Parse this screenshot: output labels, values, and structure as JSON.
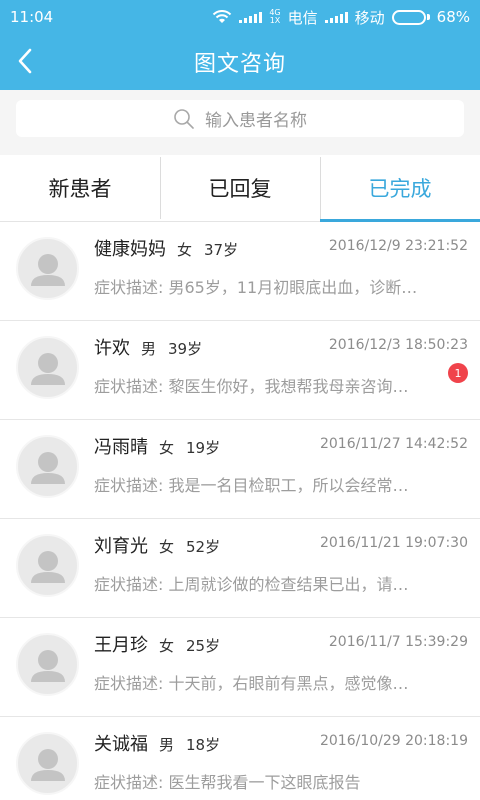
{
  "status_bar": {
    "time": "11:04",
    "net_top": "4G",
    "net_bottom": "1X",
    "carrier1": "电信",
    "carrier2": "移动",
    "battery_level": 0.68,
    "battery_text": "68%"
  },
  "header": {
    "title": "图文咨询",
    "back_icon": "chevron-left-icon"
  },
  "search": {
    "placeholder": "输入患者名称",
    "icon": "search-icon"
  },
  "tabs": [
    {
      "label": "新患者",
      "active": false
    },
    {
      "label": "已回复",
      "active": false
    },
    {
      "label": "已完成",
      "active": true
    }
  ],
  "patients": [
    {
      "name": "健康妈妈",
      "gender": "女",
      "age": "37岁",
      "time": "2016/12/9 23:21:52",
      "desc": "症状描述: 男65岁，11月初眼底出血，诊断…",
      "badge": ""
    },
    {
      "name": "许欢",
      "gender": "男",
      "age": "39岁",
      "time": "2016/12/3 18:50:23",
      "desc": "症状描述: 黎医生你好，我想帮我母亲咨询…",
      "badge": "1"
    },
    {
      "name": "冯雨晴",
      "gender": "女",
      "age": "19岁",
      "time": "2016/11/27 14:42:52",
      "desc": "症状描述: 我是一名目检职工，所以会经常…",
      "badge": ""
    },
    {
      "name": "刘育光",
      "gender": "女",
      "age": "52岁",
      "time": "2016/11/21 19:07:30",
      "desc": "症状描述: 上周就诊做的检查结果已出，请…",
      "badge": ""
    },
    {
      "name": "王月珍",
      "gender": "女",
      "age": "25岁",
      "time": "2016/11/7 15:39:29",
      "desc": "症状描述: 十天前，右眼前有黑点，感觉像…",
      "badge": ""
    },
    {
      "name": "关诚福",
      "gender": "男",
      "age": "18岁",
      "time": "2016/10/29 20:18:19",
      "desc": "症状描述: 医生帮我看一下这眼底报告",
      "badge": ""
    }
  ],
  "colors": {
    "header_bg": "#45b6e6",
    "accent": "#3aa8dc",
    "badge": "#f0434b"
  }
}
